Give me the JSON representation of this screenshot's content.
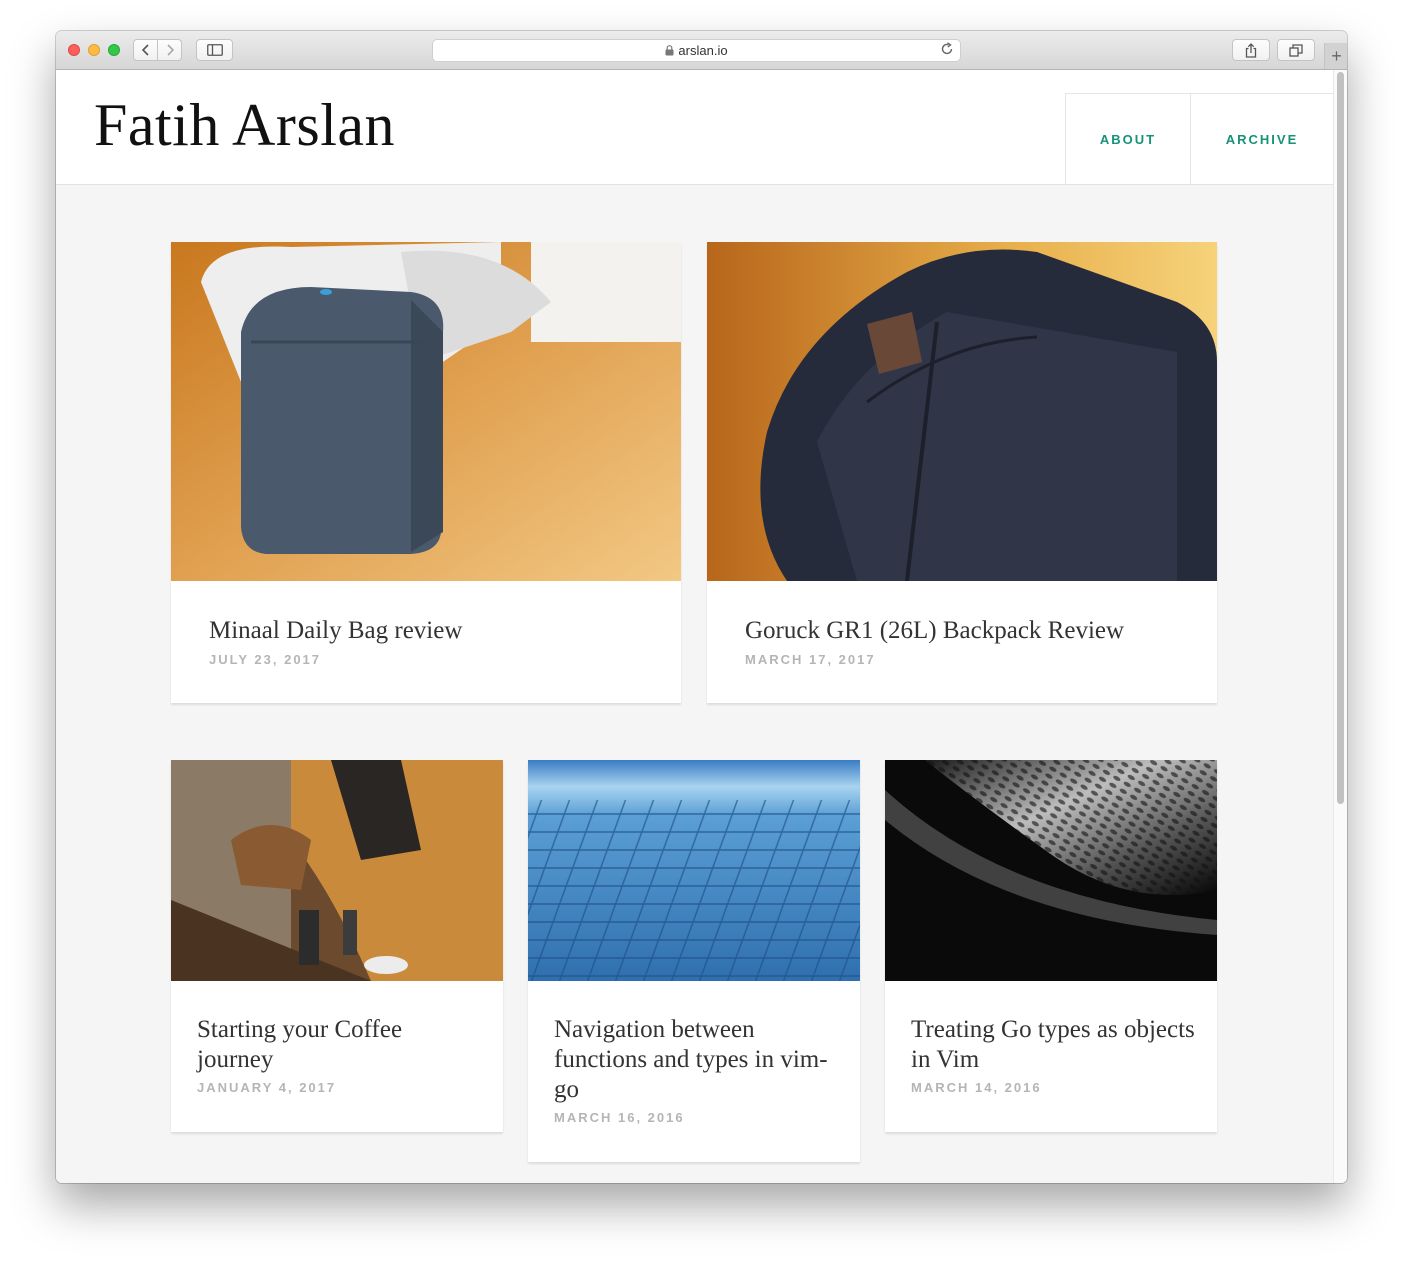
{
  "browser": {
    "url": "arslan.io",
    "newtab_symbol": "+"
  },
  "site": {
    "title": "Fatih Arslan",
    "nav": [
      {
        "label": "ABOUT"
      },
      {
        "label": "ARCHIVE"
      }
    ]
  },
  "posts": [
    {
      "title": "Minaal Daily Bag review",
      "date": "JULY 23, 2017",
      "image": "backpack-on-wooden-floor-photo"
    },
    {
      "title": "Goruck GR1 (26L) Backpack Review",
      "date": "MARCH 17, 2017",
      "image": "goruck-backpack-closeup-photo"
    },
    {
      "title": "Starting your Coffee journey",
      "date": "JANUARY 4, 2017",
      "image": "coffee-gear-on-bench-photo"
    },
    {
      "title": "Navigation between functions and types in vim-go",
      "date": "MARCH 16, 2016",
      "image": "glass-facade-photo"
    },
    {
      "title": "Treating Go types as objects in Vim",
      "date": "MARCH 14, 2016",
      "image": "black-white-architecture-photo"
    }
  ],
  "colors": {
    "accent": "#149379",
    "date_text": "#b5b5b5",
    "page_bg": "#f5f5f5"
  }
}
